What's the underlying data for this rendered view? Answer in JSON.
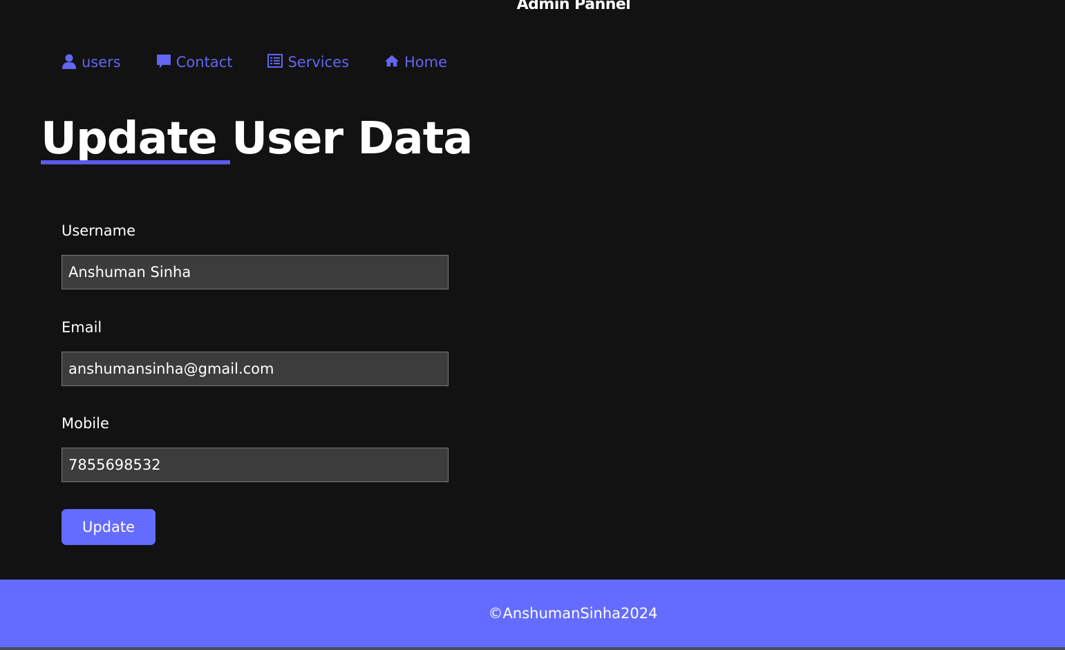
{
  "header": {
    "brand": "Admin Pannel"
  },
  "nav": {
    "items": [
      {
        "label": "users",
        "icon": "user-icon"
      },
      {
        "label": "Contact",
        "icon": "message-icon"
      },
      {
        "label": "Services",
        "icon": "list-icon"
      },
      {
        "label": "Home",
        "icon": "home-icon"
      }
    ]
  },
  "main": {
    "title": "Update User Data",
    "fields": {
      "username": {
        "label": "Username",
        "value": "Anshuman Sinha"
      },
      "email": {
        "label": "Email",
        "value": "anshumansinha@gmail.com"
      },
      "mobile": {
        "label": "Mobile",
        "value": "7855698532"
      }
    },
    "submit_label": "Update"
  },
  "footer": {
    "text": "©AnshumanSinha2024"
  },
  "colors": {
    "accent": "#646cff",
    "background": "#121212",
    "input_bg": "#3c3c3c"
  }
}
